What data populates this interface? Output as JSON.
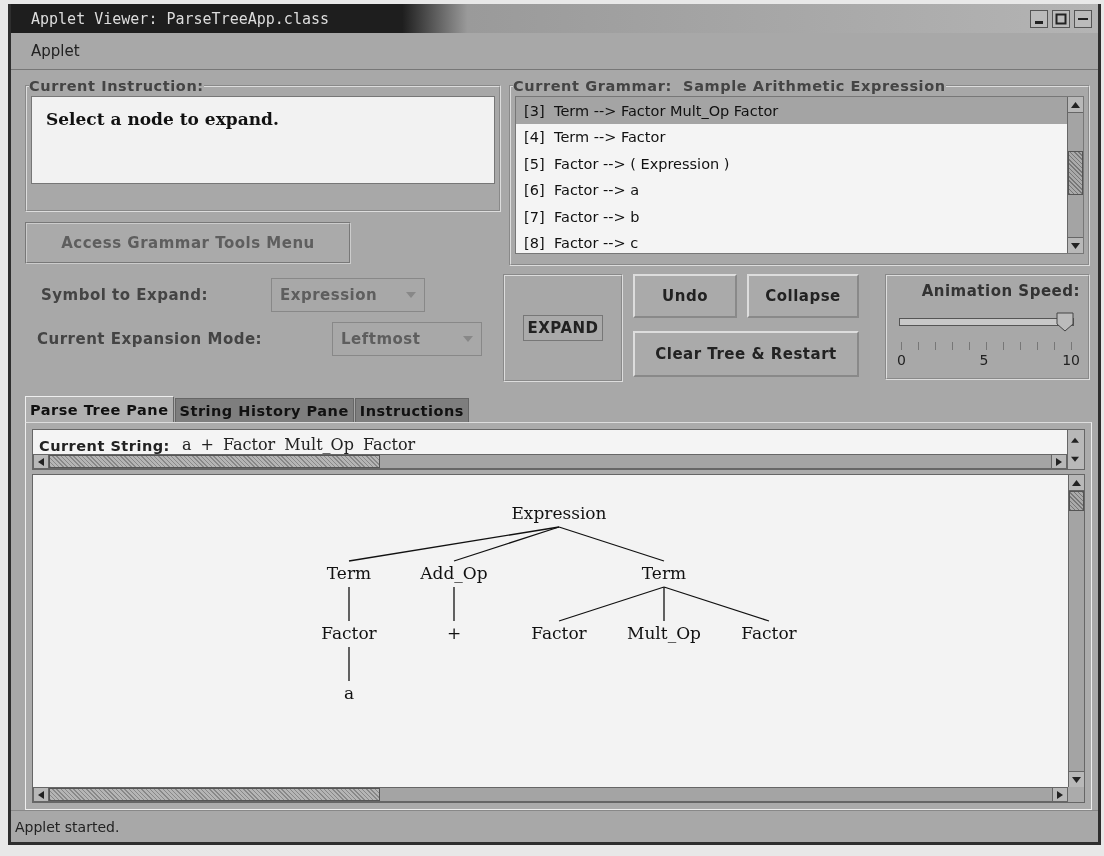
{
  "window": {
    "title": "Applet Viewer: ParseTreeApp.class"
  },
  "menu": [
    "Applet"
  ],
  "instruction": {
    "label": "Current Instruction:",
    "text": "Select a node to expand."
  },
  "grammar_tools_button": {
    "label": "Access Grammar Tools Menu",
    "disabled": true
  },
  "symbol_to_expand": {
    "label": "Symbol to Expand:",
    "value": "Expression",
    "disabled": true
  },
  "expansion_mode": {
    "label": "Current Expansion Mode:",
    "value": "Leftmost",
    "disabled": true
  },
  "grammar": {
    "label": "Current Grammar:",
    "name": "Sample Arithmetic Expression",
    "rules": [
      {
        "number": "[3]",
        "rule": "Term --> Factor Mult_Op Factor",
        "selected": true
      },
      {
        "number": "[4]",
        "rule": "Term --> Factor",
        "selected": false
      },
      {
        "number": "[5]",
        "rule": "Factor --> ( Expression )",
        "selected": false
      },
      {
        "number": "[6]",
        "rule": "Factor --> a",
        "selected": false
      },
      {
        "number": "[7]",
        "rule": "Factor --> b",
        "selected": false
      },
      {
        "number": "[8]",
        "rule": "Factor --> c",
        "selected": false
      }
    ]
  },
  "buttons": {
    "expand": "EXPAND",
    "undo": "Undo",
    "collapse": "Collapse",
    "clear": "Clear Tree & Restart"
  },
  "animation_speed": {
    "label": "Animation Speed:",
    "level": 1,
    "tick_labels": [
      "0",
      "5",
      "10"
    ]
  },
  "tabs": [
    {
      "label": "Parse Tree Pane",
      "selected": true
    },
    {
      "label": "String History Pane",
      "selected": false
    },
    {
      "label": "Instructions",
      "selected": false
    }
  ],
  "current_string": {
    "label": "Current String:",
    "value": "a + Factor Mult_Op Factor"
  },
  "parse_tree": {
    "label": "Expression",
    "children": [
      {
        "label": "Term",
        "children": [
          {
            "label": "Factor",
            "children": [
              {
                "label": "a"
              }
            ]
          }
        ]
      },
      {
        "label": "Add_Op",
        "children": [
          {
            "label": "+"
          }
        ]
      },
      {
        "label": "Term",
        "children": [
          {
            "label": "Factor"
          },
          {
            "label": "Mult_Op"
          },
          {
            "label": "Factor"
          }
        ]
      }
    ]
  },
  "status_bar": "Applet started."
}
